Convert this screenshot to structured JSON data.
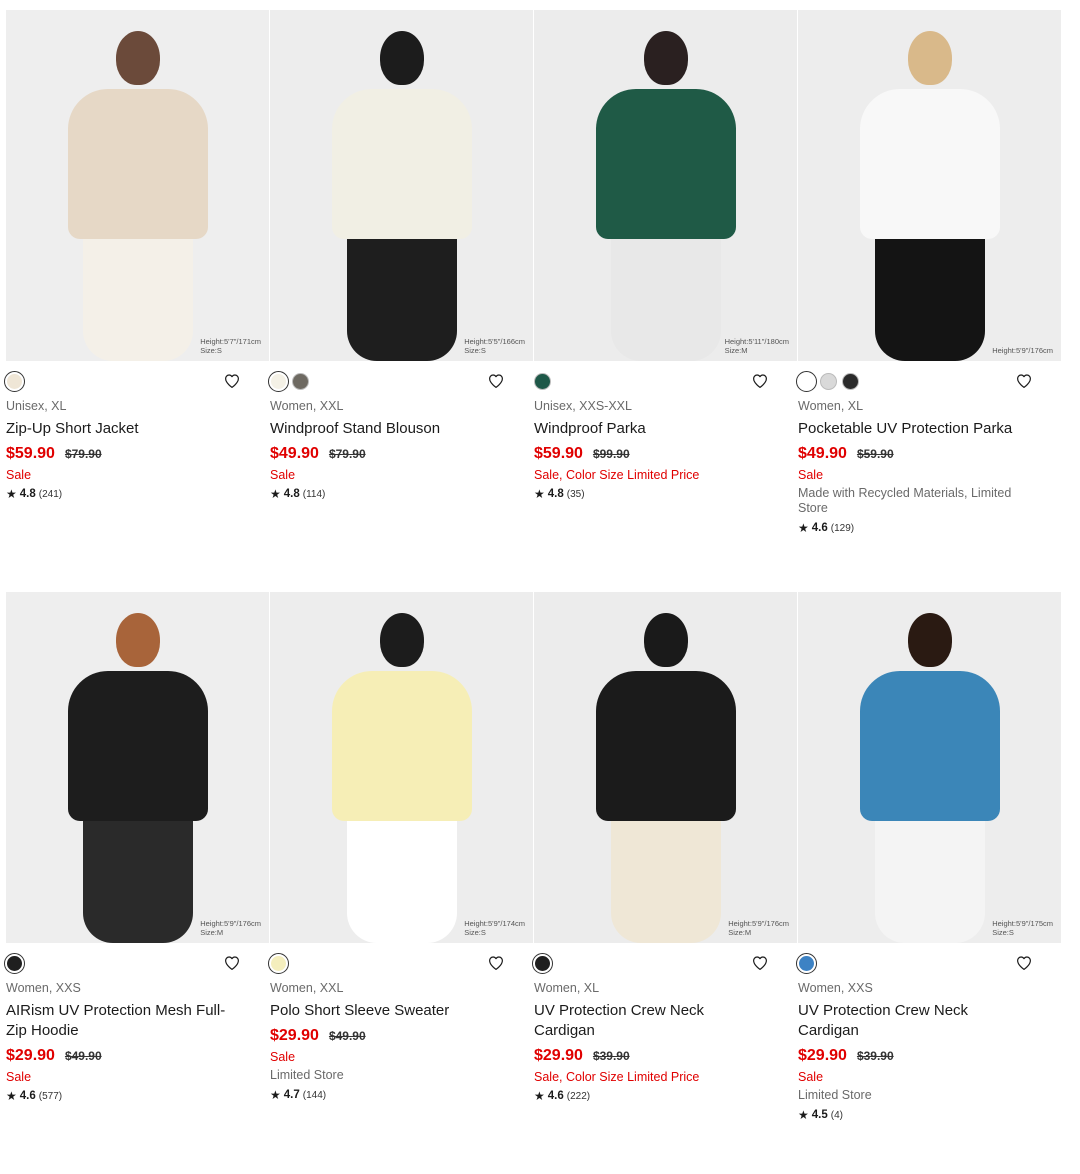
{
  "products": [
    {
      "id": "p1",
      "photo_bg": "#eeeeee",
      "figure": {
        "head": "#6b4a3a",
        "top": "#e6d8c6",
        "bottom": "#f4f0e8"
      },
      "caption": [
        "Height:5'7\"/171cm",
        "Size:S"
      ],
      "swatches": [
        {
          "color": "#efe6d6",
          "selected": true
        }
      ],
      "gender_size": "Unisex, XL",
      "name": "Zip-Up Short Jacket",
      "price": "$59.90",
      "was": "$79.90",
      "flag": "Sale",
      "note": "",
      "rating": "4.8",
      "reviews": "(241)"
    },
    {
      "id": "p2",
      "photo_bg": "#ededed",
      "figure": {
        "head": "#1c1c1c",
        "top": "#f1efe4",
        "bottom": "#1e1e1e"
      },
      "caption": [
        "Height:5'5\"/166cm",
        "Size:S"
      ],
      "swatches": [
        {
          "color": "#f4f1e6",
          "selected": true
        },
        {
          "color": "#6e6a62",
          "selected": false
        }
      ],
      "gender_size": "Women, XXL",
      "name": "Windproof Stand Blouson",
      "price": "$49.90",
      "was": "$79.90",
      "flag": "Sale",
      "note": "",
      "rating": "4.8",
      "reviews": "(114)"
    },
    {
      "id": "p3",
      "photo_bg": "#ececec",
      "figure": {
        "head": "#2a2020",
        "top": "#1f5a46",
        "bottom": "#e8e8e8"
      },
      "caption": [
        "Height:5'11\"/180cm",
        "Size:M"
      ],
      "swatches": [
        {
          "color": "#1e5848",
          "selected": false
        }
      ],
      "gender_size": "Unisex, XXS-XXL",
      "name": "Windproof Parka",
      "price": "$59.90",
      "was": "$99.90",
      "flag": "Sale, Color Size Limited Price",
      "note": "",
      "rating": "4.8",
      "reviews": "(35)"
    },
    {
      "id": "p4",
      "photo_bg": "#ededed",
      "figure": {
        "head": "#d9b98a",
        "top": "#f8f8f8",
        "bottom": "#141414"
      },
      "caption": [
        "Height:5'9\"/176cm",
        ""
      ],
      "swatches": [
        {
          "color": "#ffffff",
          "selected": true
        },
        {
          "color": "#d9d9d9",
          "selected": false
        },
        {
          "color": "#2b2b2b",
          "selected": false
        }
      ],
      "gender_size": "Women, XL",
      "name": "Pocketable UV Protection Parka",
      "price": "$49.90",
      "was": "$59.90",
      "flag": "Sale",
      "note": "Made with Recycled Materials, Limited Store",
      "rating": "4.6",
      "reviews": "(129)"
    },
    {
      "id": "p5",
      "photo_bg": "#eeeeee",
      "figure": {
        "head": "#a8643a",
        "top": "#1d1d1d",
        "bottom": "#2a2a2a"
      },
      "caption": [
        "Height:5'9\"/176cm",
        "Size:M"
      ],
      "swatches": [
        {
          "color": "#1f1f1f",
          "selected": true
        }
      ],
      "gender_size": "Women, XXS",
      "name": "AIRism UV Protection Mesh Full-Zip Hoodie",
      "price": "$29.90",
      "was": "$49.90",
      "flag": "Sale",
      "note": "",
      "rating": "4.6",
      "reviews": "(577)"
    },
    {
      "id": "p6",
      "photo_bg": "#ededed",
      "figure": {
        "head": "#1c1c1c",
        "top": "#f6eeb6",
        "bottom": "#ffffff"
      },
      "caption": [
        "Height:5'9\"/174cm",
        "Size:S"
      ],
      "swatches": [
        {
          "color": "#f4eebd",
          "selected": true
        }
      ],
      "gender_size": "Women, XXL",
      "name": "Polo Short Sleeve Sweater",
      "price": "$29.90",
      "was": "$49.90",
      "flag": "Sale",
      "note": "Limited Store",
      "rating": "4.7",
      "reviews": "(144)"
    },
    {
      "id": "p7",
      "photo_bg": "#ececec",
      "figure": {
        "head": "#1a1a1a",
        "top": "#1b1b1b",
        "bottom": "#efe7d6"
      },
      "caption": [
        "Height:5'9\"/176cm",
        "Size:M"
      ],
      "swatches": [
        {
          "color": "#1f1f1f",
          "selected": true
        }
      ],
      "gender_size": "Women, XL",
      "name": "UV Protection Crew Neck Cardigan",
      "price": "$29.90",
      "was": "$39.90",
      "flag": "Sale, Color Size Limited Price",
      "note": "",
      "rating": "4.6",
      "reviews": "(222)"
    },
    {
      "id": "p8",
      "photo_bg": "#ededed",
      "figure": {
        "head": "#2a1a12",
        "top": "#3b86b8",
        "bottom": "#f4f4f4"
      },
      "caption": [
        "Height:5'9\"/175cm",
        "Size:S"
      ],
      "swatches": [
        {
          "color": "#3d82c4",
          "selected": true
        }
      ],
      "gender_size": "Women, XXS",
      "name": "UV Protection Crew Neck Cardigan",
      "price": "$29.90",
      "was": "$39.90",
      "flag": "Sale",
      "note": "Limited Store",
      "rating": "4.5",
      "reviews": "(4)"
    }
  ],
  "icons": {
    "favorite": "heart-outline-icon",
    "rating": "star-icon"
  },
  "colors": {
    "sale_red": "#e00000",
    "muted_text": "#6a6a6a"
  }
}
